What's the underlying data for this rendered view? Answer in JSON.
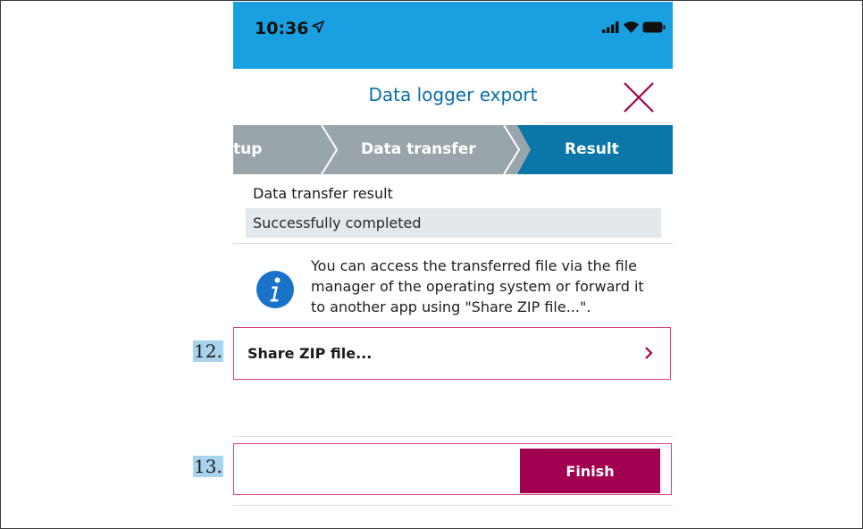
{
  "status_bar": {
    "time": "10:36"
  },
  "header": {
    "title": "Data logger export"
  },
  "stepper": {
    "steps": [
      {
        "label": "tup",
        "state": "done"
      },
      {
        "label": "Data transfer",
        "state": "done"
      },
      {
        "label": "Result",
        "state": "active"
      }
    ]
  },
  "result": {
    "label": "Data transfer result",
    "value": "Successfully completed"
  },
  "info": {
    "lines": [
      "You can access the transferred file via the file",
      "manager of the operating system or forward it",
      "to another app using \"Share ZIP file...\"."
    ]
  },
  "steps_annotations": {
    "share_step": "12.",
    "finish_step": "13."
  },
  "share": {
    "label": "Share ZIP file..."
  },
  "finish": {
    "label": "Finish"
  },
  "colors": {
    "status_bar": "#1aa0e0",
    "title": "#0b6fa8",
    "step_done": "#9aa5ab",
    "step_active": "#0a77a8",
    "close_icon": "#a0004f",
    "finish_button": "#a0004f",
    "highlight_border": "#d4407e",
    "step_number_bg": "#a8d3ec"
  },
  "icons": {
    "location": "location-arrow-icon",
    "signal": "signal-icon",
    "wifi": "wifi-icon",
    "battery": "battery-icon",
    "close": "close-icon",
    "info": "info-icon",
    "chevron": "chevron-right-icon"
  }
}
